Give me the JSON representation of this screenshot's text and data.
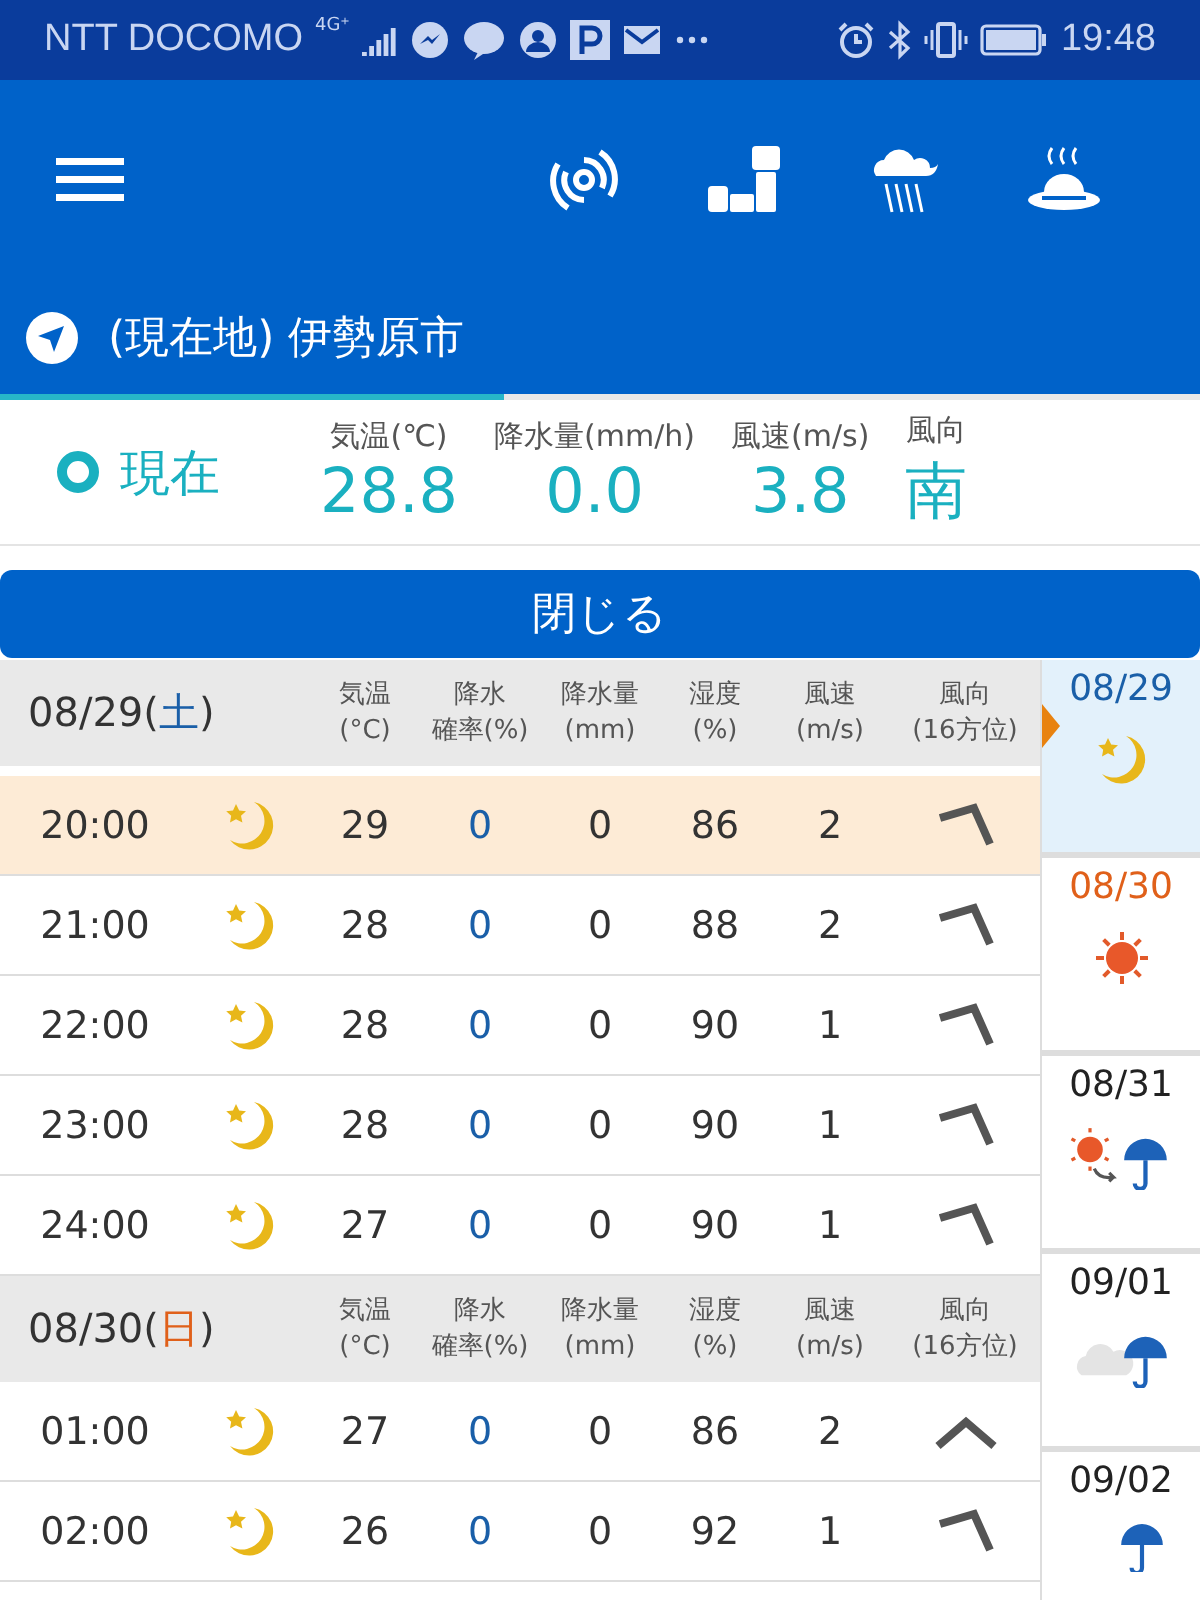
{
  "status_bar": {
    "carrier": "NTT DOCOMO",
    "network": "4G⁺",
    "time": "19:48"
  },
  "location": {
    "name": "(現在地) 伊勢原市"
  },
  "current": {
    "label": "現在",
    "readings": [
      {
        "heading": "気温(℃)",
        "value": "28.8"
      },
      {
        "heading": "降水量(mm/h)",
        "value": "0.0"
      },
      {
        "heading": "風速(m/s)",
        "value": "3.8"
      },
      {
        "heading": "風向",
        "value": "南"
      }
    ]
  },
  "close_button": "閉じる",
  "days": [
    {
      "date": "08/29",
      "weekday": "(土)",
      "color": "#1a5fa8",
      "headers": [
        {
          "top": "気温",
          "bottom": "(°C)"
        },
        {
          "top": "降水",
          "bottom": "確率(%)"
        },
        {
          "top": "降水量",
          "bottom": "(mm)"
        },
        {
          "top": "湿度",
          "bottom": "(%)"
        },
        {
          "top": "風速",
          "bottom": "(m/s)"
        },
        {
          "top": "風向",
          "bottom": "(16方位)"
        }
      ],
      "rows": [
        {
          "time": "20:00",
          "weather": {
            "kind": "moon"
          },
          "temp": "29",
          "precip_prob": "0",
          "precip": "0",
          "humidity": "86",
          "wind_speed": "2",
          "wind": {
            "kind": "tilted"
          },
          "selected": true
        },
        {
          "time": "21:00",
          "weather": {
            "kind": "moon"
          },
          "temp": "28",
          "precip_prob": "0",
          "precip": "0",
          "humidity": "88",
          "wind_speed": "2",
          "wind": {
            "kind": "tilted"
          },
          "selected": false
        },
        {
          "time": "22:00",
          "weather": {
            "kind": "moon"
          },
          "temp": "28",
          "precip_prob": "0",
          "precip": "0",
          "humidity": "90",
          "wind_speed": "1",
          "wind": {
            "kind": "tilted"
          },
          "selected": false
        },
        {
          "time": "23:00",
          "weather": {
            "kind": "moon"
          },
          "temp": "28",
          "precip_prob": "0",
          "precip": "0",
          "humidity": "90",
          "wind_speed": "1",
          "wind": {
            "kind": "tilted"
          },
          "selected": false
        },
        {
          "time": "24:00",
          "weather": {
            "kind": "moon"
          },
          "temp": "27",
          "precip_prob": "0",
          "precip": "0",
          "humidity": "90",
          "wind_speed": "1",
          "wind": {
            "kind": "tilted"
          },
          "selected": false
        }
      ]
    },
    {
      "date": "08/30",
      "weekday": "(日)",
      "color": "#e0601a",
      "headers": [
        {
          "top": "気温",
          "bottom": "(°C)"
        },
        {
          "top": "降水",
          "bottom": "確率(%)"
        },
        {
          "top": "降水量",
          "bottom": "(mm)"
        },
        {
          "top": "湿度",
          "bottom": "(%)"
        },
        {
          "top": "風速",
          "bottom": "(m/s)"
        },
        {
          "top": "風向",
          "bottom": "(16方位)"
        }
      ],
      "rows": [
        {
          "time": "01:00",
          "weather": {
            "kind": "moon"
          },
          "temp": "27",
          "precip_prob": "0",
          "precip": "0",
          "humidity": "86",
          "wind_speed": "2",
          "wind": {
            "kind": "up"
          },
          "selected": false
        },
        {
          "time": "02:00",
          "weather": {
            "kind": "moon"
          },
          "temp": "26",
          "precip_prob": "0",
          "precip": "0",
          "humidity": "92",
          "wind_speed": "1",
          "wind": {
            "kind": "tilted"
          },
          "selected": false
        }
      ]
    }
  ],
  "day_list": [
    {
      "date": "08/29",
      "color": "#1a5fa8",
      "weather": {
        "kind": "moon"
      },
      "selected": true
    },
    {
      "date": "08/30",
      "color": "#e0601a",
      "weather": {
        "kind": "sun"
      },
      "selected": false
    },
    {
      "date": "08/31",
      "color": "#222222",
      "weather": {
        "kind": "sun-to-rain"
      },
      "selected": false
    },
    {
      "date": "09/01",
      "color": "#222222",
      "weather": {
        "kind": "cloud-rain"
      },
      "selected": false
    },
    {
      "date": "09/02",
      "color": "#222222",
      "weather": {
        "kind": "rain"
      },
      "selected": false
    }
  ]
}
